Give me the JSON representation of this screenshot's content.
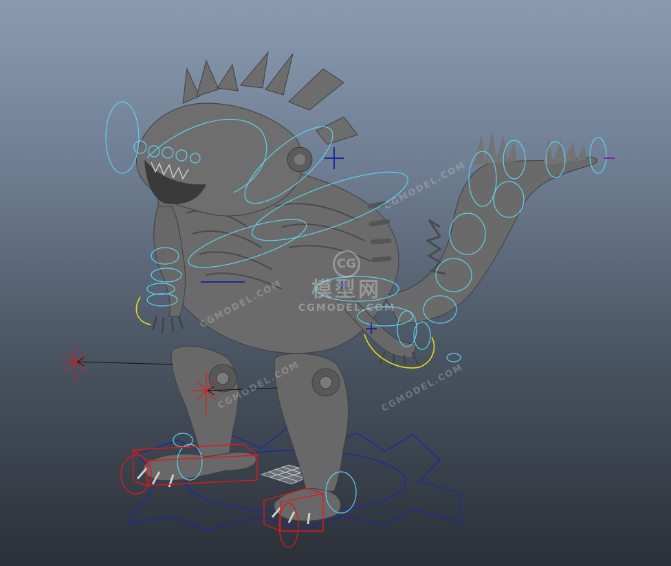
{
  "viewport": {
    "background_top": "#8a9bb1",
    "background_bottom": "#2b3038",
    "content": "rigged-creature-model"
  },
  "colors": {
    "mesh": "#6b6b6b",
    "control_cyan": "#5fd3f0",
    "control_yellow": "#e6dc12",
    "control_red": "#e01818",
    "control_blue": "#1a2aa0"
  },
  "watermark": {
    "logo_letter": "CG",
    "center_cn": "模型网",
    "center_en": "CGMODEL.COM",
    "diagonal_1": "CGMODEL.COM",
    "diagonal_2": "CGMODEL.COM",
    "diagonal_3": "CGMODEL.COM",
    "diagonal_4": "CGMODEL.COM"
  }
}
